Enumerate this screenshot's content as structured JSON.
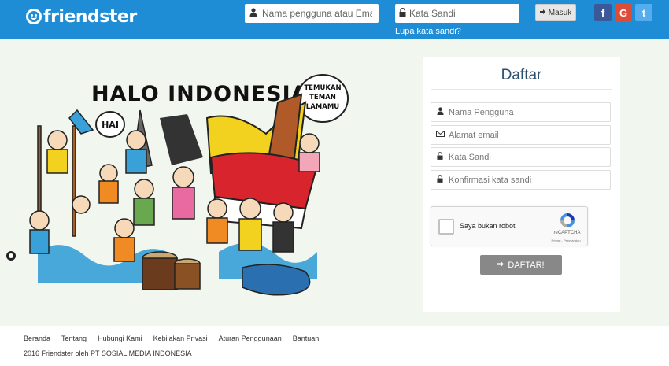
{
  "header": {
    "logo_text": "friendster",
    "username_placeholder": "Nama pengguna atau Email",
    "password_placeholder": "Kata Sandi",
    "login_label": "Masuk",
    "forgot_label": "Lupa kata sandi?",
    "social": {
      "facebook": "f",
      "google": "G",
      "twitter": "t"
    }
  },
  "illustration": {
    "headline": "HALO INDONESIA",
    "bubble_left": "HAI",
    "bubble_right_line1": "TEMUKAN",
    "bubble_right_line2": "TEMAN",
    "bubble_right_line3": "LAMAMU"
  },
  "register": {
    "title": "Daftar",
    "username_placeholder": "Nama Pengguna",
    "email_placeholder": "Alamat email",
    "password_placeholder": "Kata Sandi",
    "confirm_placeholder": "Konfirmasi kata sandi",
    "captcha_label": "Saya bukan robot",
    "captcha_brand": "reCAPTCHA",
    "captcha_terms": "Privasi - Persyaratan",
    "submit_label": "DAFTAR!"
  },
  "footer": {
    "links": [
      "Beranda",
      "Tentang",
      "Hubungi Kami",
      "Kebijakan Privasi",
      "Aturan Penggunaan",
      "Bantuan"
    ],
    "copyright": "2016 Friendster  oleh PT SOSIAL MEDIA INDONESIA"
  },
  "colors": {
    "header": "#1f8dd6",
    "background": "#f1f6ef",
    "title": "#2a4f6d",
    "submit": "#888888",
    "facebook": "#3b5998",
    "google": "#dd4b39",
    "twitter": "#55acee"
  }
}
